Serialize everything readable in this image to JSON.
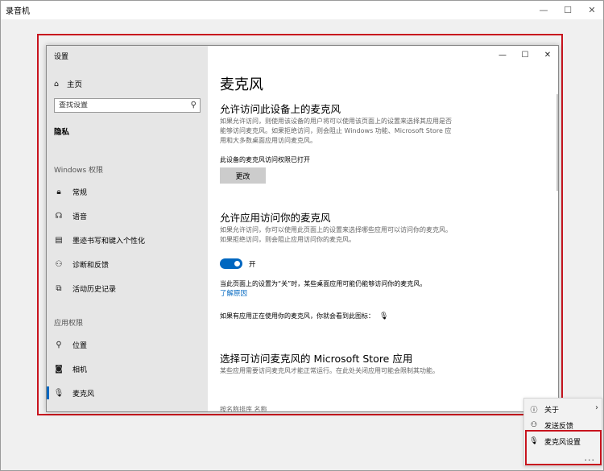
{
  "app": {
    "title": "录音机",
    "controls": {
      "minimize": "—",
      "maximize": "☐",
      "close": "✕"
    }
  },
  "settings": {
    "window_title": "设置",
    "controls": {
      "minimize": "—",
      "maximize": "☐",
      "close": "✕"
    },
    "nav": {
      "home": "主页",
      "search_placeholder": "查找设置",
      "current_section": "隐私",
      "windows_permissions_header": "Windows 权限",
      "windows_items": [
        {
          "label": "常规",
          "icon": "lock-icon"
        },
        {
          "label": "语音",
          "icon": "speech-icon"
        },
        {
          "label": "墨迹书写和键入个性化",
          "icon": "inking-icon"
        },
        {
          "label": "诊断和反馈",
          "icon": "diagnostics-icon"
        },
        {
          "label": "活动历史记录",
          "icon": "activity-history-icon"
        }
      ],
      "app_permissions_header": "应用权限",
      "app_items": [
        {
          "label": "位置",
          "icon": "location-icon"
        },
        {
          "label": "相机",
          "icon": "camera-icon"
        },
        {
          "label": "麦克风",
          "icon": "microphone-icon",
          "selected": true
        }
      ]
    },
    "content": {
      "title": "麦克风",
      "device_section": {
        "heading": "允许访问此设备上的麦克风",
        "description": "如果允许访问，则使用该设备的用户将可以使用该页面上的设置来选择其应用是否能够访问麦克风。如果拒绝访问，则会阻止 Windows 功能、Microsoft Store 应用和大多数桌面应用访问麦克风。",
        "status": "此设备的麦克风访问权限已打开",
        "change_button": "更改"
      },
      "apps_section": {
        "heading": "允许应用访问你的麦克风",
        "description": "如果允许访问，你可以使用此页面上的设置来选择哪些应用可以访问你的麦克风。如果拒绝访问，则会阻止应用访问你的麦克风。",
        "toggle_label": "开",
        "toggle_on": true,
        "note": "当此页面上的设置为“关”时，某些桌面应用可能仍能够访问你的麦克风。",
        "learn_more": "了解原因",
        "in_use_note": "如果有应用正在使用你的麦克风，你就会看到此图标："
      },
      "store_section": {
        "heading": "选择可访问麦克风的 Microsoft Store 应用",
        "description": "某些应用需要访问麦克风才能正常运行。在此处关闭应用可能会限制其功能。",
        "cutoff_text": "按名称排序  名称"
      }
    }
  },
  "menu": {
    "items": [
      {
        "label": "关于",
        "icon": "info-icon",
        "has_submenu": true
      },
      {
        "label": "发送反馈",
        "icon": "feedback-icon"
      },
      {
        "label": "麦克风设置",
        "icon": "microphone-icon"
      }
    ],
    "more": "..."
  },
  "colors": {
    "accent": "#0067c0",
    "highlight": "#c8141e"
  }
}
